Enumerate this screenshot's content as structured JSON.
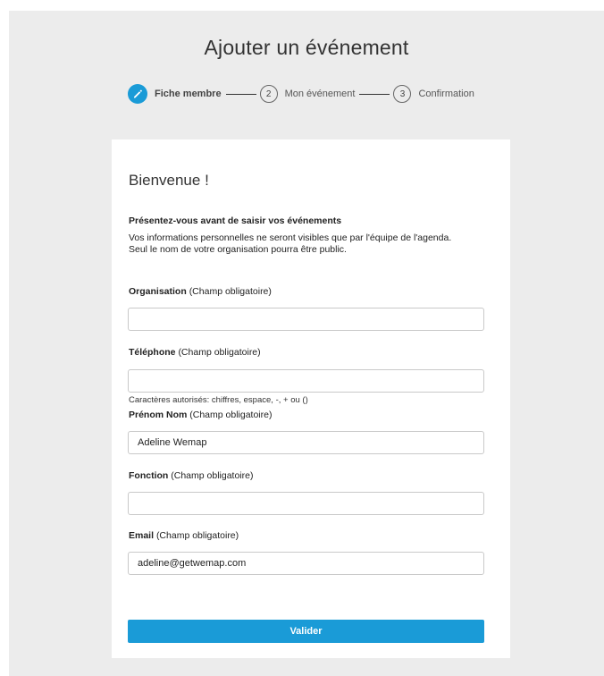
{
  "header": {
    "title": "Ajouter un événement"
  },
  "stepper": {
    "steps": [
      {
        "number": "",
        "label": "Fiche membre",
        "active": true,
        "icon": "pencil-icon"
      },
      {
        "number": "2",
        "label": "Mon événement",
        "active": false
      },
      {
        "number": "3",
        "label": "Confirmation",
        "active": false
      }
    ]
  },
  "colors": {
    "accent": "#1a9bd7",
    "background": "#ececec",
    "card": "#ffffff"
  },
  "form": {
    "welcome": "Bienvenue !",
    "intro_heading": "Présentez-vous avant de saisir vos événements",
    "intro_lines": [
      "Vos informations personnelles ne seront visibles que par l'équipe de l'agenda.",
      "Seul le nom de votre organisation pourra être public."
    ],
    "fields": [
      {
        "label": "Organisation",
        "hint": "(Champ obligatoire)",
        "value": "",
        "placeholder": ""
      },
      {
        "label": "Téléphone",
        "hint": "(Champ obligatoire)",
        "value": "",
        "placeholder": "",
        "help": "Caractères autorisés: chiffres, espace, -, + ou ()"
      },
      {
        "label": "Prénom Nom",
        "hint": "(Champ obligatoire)",
        "value": "Adeline Wemap",
        "placeholder": ""
      },
      {
        "label": "Fonction",
        "hint": "(Champ obligatoire)",
        "value": "",
        "placeholder": ""
      },
      {
        "label": "Email",
        "hint": "(Champ obligatoire)",
        "value": "adeline@getwemap.com",
        "placeholder": ""
      }
    ],
    "submit_label": "Valider"
  }
}
